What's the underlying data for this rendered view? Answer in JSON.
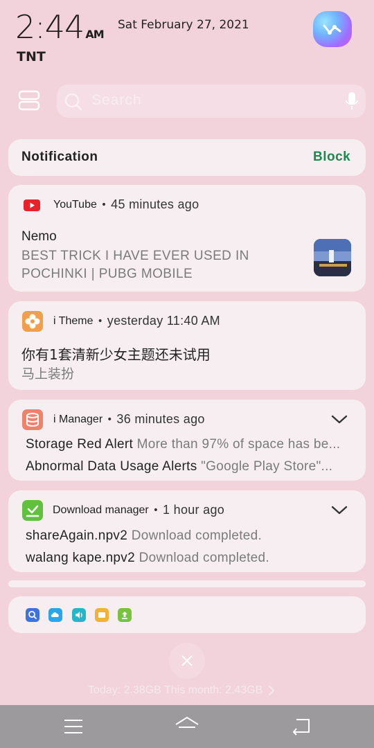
{
  "status": {
    "time": "2:44",
    "ampm": "AM",
    "date": "Sat February 27, 2021",
    "carrier": "TNT"
  },
  "search": {
    "placeholder": "Search"
  },
  "notification_header": {
    "title": "Notification",
    "block_label": "Block"
  },
  "notifications": [
    {
      "app": "YouTube",
      "time": "45 minutes ago",
      "sender": "Nemo",
      "body": "BEST TRICK I HAVE EVER USED IN POCHINKI | PUBG MOBILE",
      "icon": "youtube-icon"
    },
    {
      "app": "i Theme",
      "time": "yesterday 11:40 AM",
      "line1": "你有1套清新少女主题还未试用",
      "line2": "马上装扮",
      "icon": "itheme-icon"
    },
    {
      "app": "i Manager",
      "time": "36 minutes ago",
      "items": [
        {
          "title": "Storage Red Alert",
          "detail": "More than 97% of space has be..."
        },
        {
          "title": "Abnormal Data Usage Alerts",
          "detail": "\"Google Play Store\"..."
        }
      ],
      "icon": "imanager-icon"
    },
    {
      "app": "Download manager",
      "time": "1 hour ago",
      "items": [
        {
          "title": "shareAgain.npv2",
          "detail": "Download completed."
        },
        {
          "title": "walang kape.npv2",
          "detail": "Download completed."
        }
      ],
      "icon": "download-manager-icon"
    }
  ],
  "data_usage": {
    "text": "Today: 2.38GB This month: 2.43GB"
  },
  "colors": {
    "background": "#f2d3dc",
    "card": "#f7eef1",
    "block_green": "#1c8a4f",
    "youtube_red": "#e6232a"
  }
}
